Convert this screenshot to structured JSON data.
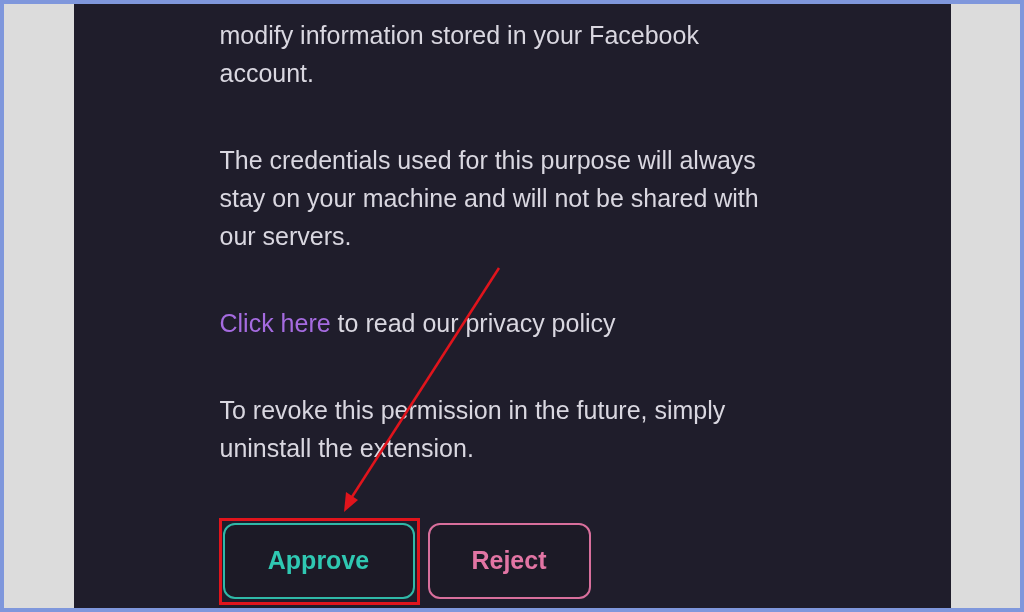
{
  "paragraphs": [
    {
      "kind": "text",
      "lines": [
        "modify information stored in your Facebook",
        "account."
      ]
    },
    {
      "kind": "text",
      "lines": [
        "The credentials used for this purpose will always",
        "stay on your machine and will not be shared with",
        "our servers."
      ]
    },
    {
      "kind": "link",
      "link": "Click here",
      "rest": " to read our privacy policy"
    },
    {
      "kind": "text",
      "lines": [
        "To revoke this permission in the future, simply",
        "uninstall the extension."
      ]
    }
  ],
  "buttons": [
    {
      "label": "Approve",
      "kind": "approve",
      "highlighted": true
    },
    {
      "label": "Reject",
      "kind": "reject",
      "highlighted": false
    }
  ],
  "annotations": [
    {
      "kind": "arrow"
    }
  ]
}
